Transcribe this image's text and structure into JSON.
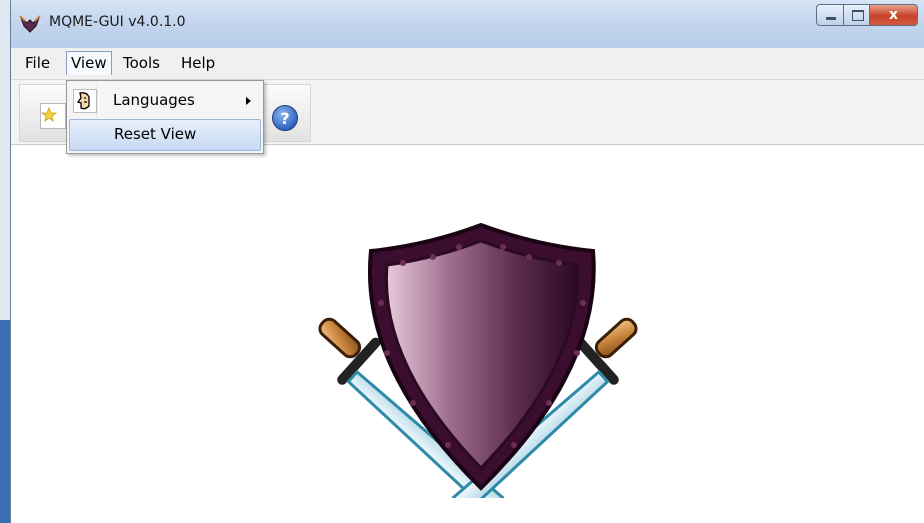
{
  "window": {
    "title": "MQME-GUI v4.0.1.0",
    "close_glyph": "x"
  },
  "menubar": {
    "items": [
      {
        "label": "File"
      },
      {
        "label": "View"
      },
      {
        "label": "Tools"
      },
      {
        "label": "Help"
      }
    ]
  },
  "view_menu": {
    "items": [
      {
        "label": "Languages",
        "icon": "speech-face-icon",
        "has_submenu": true
      },
      {
        "label": "Reset View",
        "highlighted": true
      }
    ]
  },
  "toolbar": {
    "help_glyph": "?"
  },
  "colors": {
    "shield": "#5a2a4a",
    "shield_rim": "#3b0d2e",
    "sword_handle": "#c9843d",
    "blade_edge": "#2e8aa8",
    "highlight": "#c6d9f3"
  }
}
